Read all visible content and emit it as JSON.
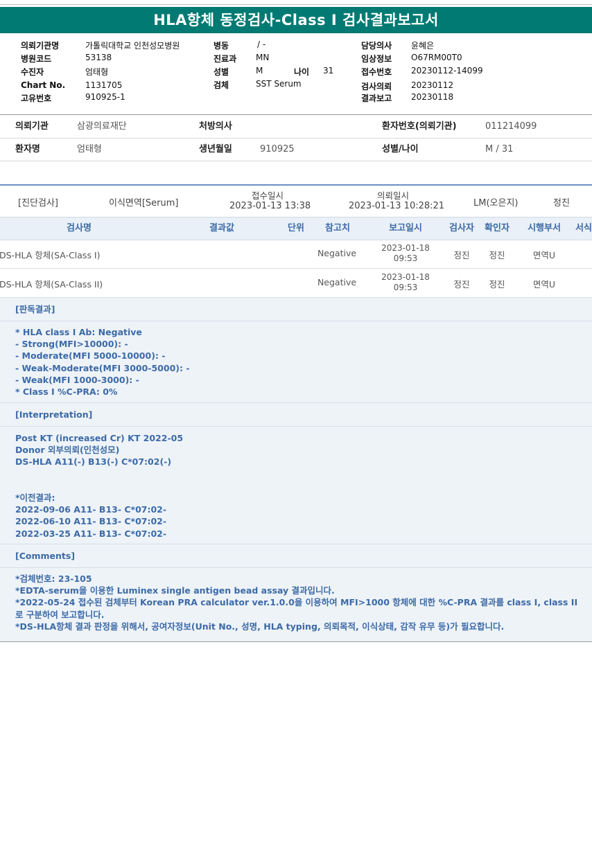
{
  "title": "HLA항체 동정검사-Class I 검사결과보고서",
  "header": {
    "col1": [
      {
        "label": "의뢰기관명",
        "value": "가톨릭대학교 인천성모병원"
      },
      {
        "label": "병원코드",
        "value": "53138"
      },
      {
        "label": "수진자",
        "value": "엄태형"
      },
      {
        "label": "Chart No.",
        "value": "1131705"
      },
      {
        "label": "고유번호",
        "value": "910925-1"
      }
    ],
    "col2": [
      {
        "label": "병동",
        "value": "/ -"
      },
      {
        "label": "진료과",
        "value": "MN"
      },
      {
        "label": "성별",
        "value": "M"
      },
      {
        "label": "검체",
        "value": "SST Serum"
      }
    ],
    "age": {
      "label": "나이",
      "value": "31"
    },
    "col3": [
      {
        "label": "담당의사",
        "value": "윤혜은"
      },
      {
        "label": "임상정보",
        "value": "O67RM00T0"
      },
      {
        "label": "접수번호",
        "value": "20230112-14099"
      },
      {
        "label": "검사의뢰",
        "value": "20230112"
      },
      {
        "label": "결과보고",
        "value": "20230118"
      }
    ]
  },
  "info": {
    "row1": {
      "l1": "의뢰기관",
      "v1": "삼광의료재단",
      "l2": "처방의사",
      "v2": "",
      "l3": "환자번호(의뢰기관)",
      "v3": "011214099"
    },
    "row2": {
      "l1": "환자명",
      "v1": "엄태형",
      "l2": "생년월일",
      "v2": "910925",
      "l3": "성별/나이",
      "v3": "M / 31"
    }
  },
  "jd": {
    "category": "[진단검사]",
    "dept": "이식면역[Serum]",
    "received_label": "접수일시",
    "received": "2023-01-13 13:38",
    "requested_label": "의뢰일시",
    "requested": "2023-01-13 10:28:21",
    "lm": "LM(오은지)",
    "tester": "정진"
  },
  "table": {
    "headers": [
      "검사명",
      "결과값",
      "단위",
      "참고치",
      "보고일시",
      "검사자",
      "확인자",
      "시행부서",
      "서식"
    ],
    "rows": [
      {
        "name": "DS-HLA 항체(SA-Class I)",
        "ref": "Negative",
        "date": "2023-01-18",
        "time": "09:53",
        "tester": "정진",
        "confirmer": "정진",
        "dept": "면역U"
      },
      {
        "name": "DS-HLA 항체(SA-Class II)",
        "ref": "Negative",
        "date": "2023-01-18",
        "time": "09:53",
        "tester": "정진",
        "confirmer": "정진",
        "dept": "면역U"
      }
    ]
  },
  "sections": {
    "s1": {
      "title": "[판독결과]",
      "lines": [
        "* HLA class I Ab: Negative",
        "- Strong(MFI>10000): -",
        "- Moderate(MFI 5000-10000): -",
        "- Weak-Moderate(MFI 3000-5000): -",
        "- Weak(MFI 1000-3000): -",
        "* Class I %C-PRA: 0%"
      ]
    },
    "s2": {
      "title": "[Interpretation]",
      "lines": [
        "Post KT (increased Cr) KT 2022-05",
        "Donor 외부의뢰(인천성모)",
        "DS-HLA A11(-) B13(-) C*07:02(-)",
        "",
        "",
        "*이전결과:",
        "2022-09-06 A11- B13- C*07:02-",
        "2022-06-10 A11- B13- C*07:02-",
        "2022-03-25 A11- B13- C*07:02-"
      ]
    },
    "s3": {
      "title": "[Comments]",
      "lines": [
        "*검체번호: 23-105",
        "*EDTA-serum을 이용한 Luminex single antigen bead assay 결과입니다.",
        "*2022-05-24 접수된 검체부터 Korean PRA calculator ver.1.0.0을 이용하여 MFI>1000 항체에 대한 %C-PRA 결과를 class I, class II로 구분하여 보고합니다.",
        "*DS-HLA항체 결과 판정을 위해서, 공여자정보(Unit No., 성명, HLA typing, 의뢰목적, 이식상태, 감작 유무 등)가 필요합니다."
      ]
    }
  }
}
